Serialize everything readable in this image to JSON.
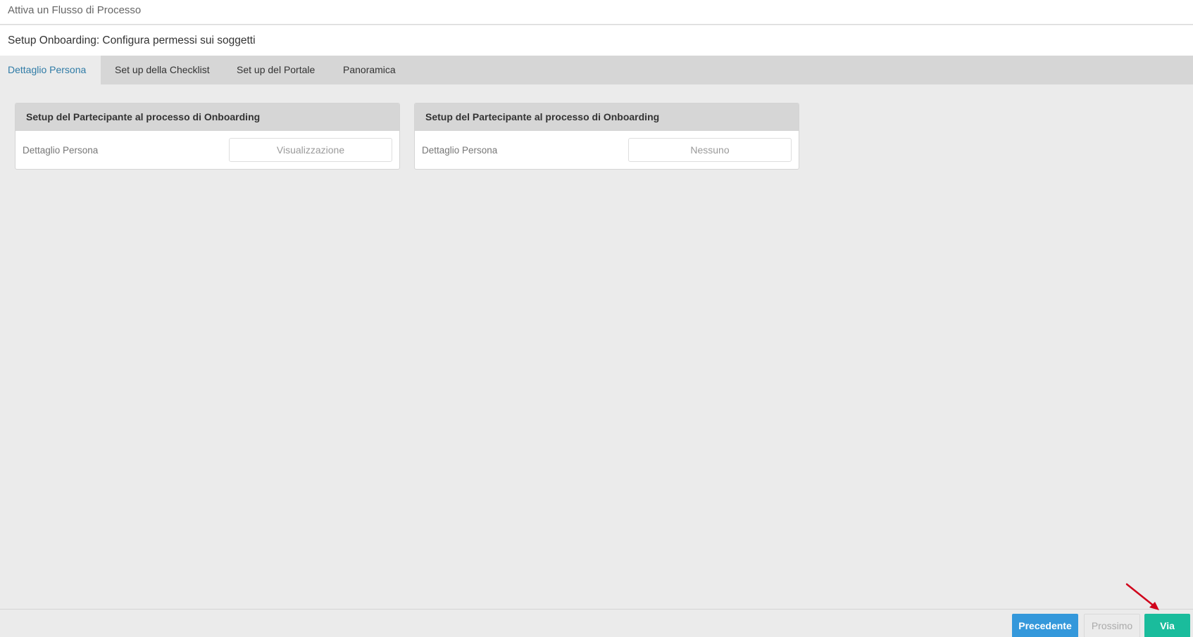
{
  "window": {
    "title": "Attiva un Flusso di Processo"
  },
  "page": {
    "title": "Setup Onboarding: Configura permessi sui soggetti"
  },
  "tabs": [
    {
      "label": "Dettaglio Persona",
      "active": true
    },
    {
      "label": "Set up della Checklist",
      "active": false
    },
    {
      "label": "Set up del Portale",
      "active": false
    },
    {
      "label": "Panoramica",
      "active": false
    }
  ],
  "panels": [
    {
      "header": "Setup del Partecipante al processo di Onboarding",
      "row_label": "Dettaglio Persona",
      "row_value": "Visualizzazione"
    },
    {
      "header": "Setup del Partecipante al processo di Onboarding",
      "row_label": "Dettaglio Persona",
      "row_value": "Nessuno"
    }
  ],
  "footer": {
    "prev_label": "Precedente",
    "next_label": "Prossimo",
    "go_label": "Via"
  },
  "colors": {
    "active_tab_text": "#2f7ba6",
    "prev_button": "#3498db",
    "go_button": "#1abc9c",
    "annotation_arrow": "#d0021b"
  },
  "icons": {
    "annotation": "red-arrow-icon"
  }
}
